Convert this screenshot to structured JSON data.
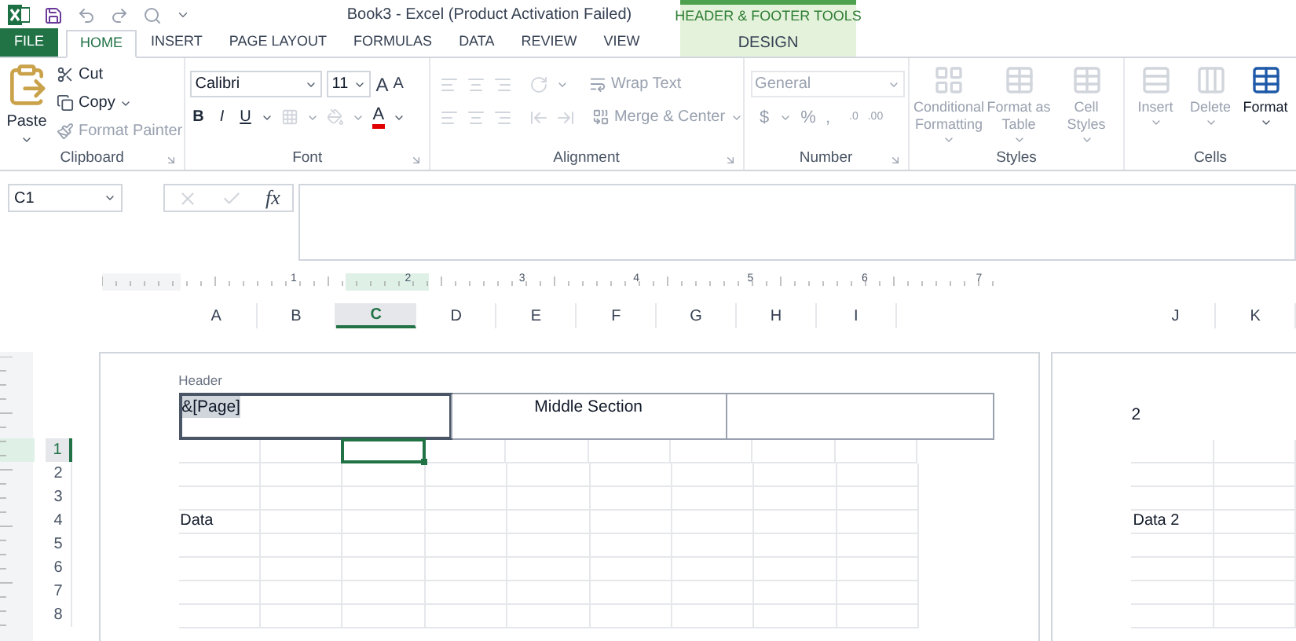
{
  "window": {
    "title": "Book3 - Excel (Product Activation Failed)"
  },
  "contextual_group": {
    "label": "HEADER & FOOTER TOOLS"
  },
  "tabs": [
    {
      "label": "FILE",
      "kind": "file",
      "selected": false
    },
    {
      "label": "HOME",
      "kind": "main",
      "selected": true
    },
    {
      "label": "INSERT",
      "kind": "main",
      "selected": false
    },
    {
      "label": "PAGE LAYOUT",
      "kind": "main",
      "selected": false
    },
    {
      "label": "FORMULAS",
      "kind": "main",
      "selected": false
    },
    {
      "label": "DATA",
      "kind": "main",
      "selected": false
    },
    {
      "label": "REVIEW",
      "kind": "main",
      "selected": false
    },
    {
      "label": "VIEW",
      "kind": "main",
      "selected": false
    },
    {
      "label": "DESIGN",
      "kind": "contextual",
      "selected": false
    }
  ],
  "ribbon_groups": [
    {
      "kind": "clipboard",
      "label": "Clipboard",
      "buttons": [
        {
          "label": "Paste",
          "disabled": false
        },
        {
          "label": "Cut",
          "disabled": false
        },
        {
          "label": "Copy",
          "disabled": false
        },
        {
          "label": "Format Painter",
          "disabled": true
        }
      ]
    },
    {
      "kind": "font",
      "label": "Font",
      "font_name": "Calibri",
      "font_size": "11",
      "size_buttons": [
        "A",
        "A"
      ],
      "style_buttons": [
        "B",
        "I",
        "U"
      ],
      "font_color": "A"
    },
    {
      "kind": "alignment",
      "label": "Alignment",
      "buttons": [
        {
          "label": "Wrap Text",
          "disabled": true
        },
        {
          "label": "Merge & Center",
          "disabled": true
        }
      ]
    },
    {
      "kind": "number",
      "label": "Number",
      "format": "General",
      "disabled": true,
      "symbols": [
        "$",
        "%",
        ","
      ],
      "decimal_buttons": [
        ".0",
        ".00"
      ]
    },
    {
      "kind": "large",
      "label": "Styles",
      "buttons": [
        {
          "label": "Conditional Formatting",
          "disabled": true
        },
        {
          "label": "Format as Table",
          "disabled": true
        },
        {
          "label": "Cell Styles",
          "disabled": true
        }
      ]
    },
    {
      "kind": "large",
      "label": "Cells",
      "buttons": [
        {
          "label": "Insert",
          "disabled": true
        },
        {
          "label": "Delete",
          "disabled": true
        },
        {
          "label": "Format",
          "disabled": false
        }
      ]
    }
  ],
  "formula_bar": {
    "function_label": "fx"
  },
  "ruler_marks": [
    "1",
    "2",
    "3",
    "4",
    "5",
    "6",
    "7"
  ],
  "sheet": {
    "active_cell": "C1",
    "columns": [
      {
        "label": "A",
        "selected": false
      },
      {
        "label": "B",
        "selected": false
      },
      {
        "label": "C",
        "selected": true
      },
      {
        "label": "D",
        "selected": false
      },
      {
        "label": "E",
        "selected": false
      },
      {
        "label": "F",
        "selected": false
      },
      {
        "label": "G",
        "selected": false
      },
      {
        "label": "H",
        "selected": false
      },
      {
        "label": "I",
        "selected": false
      }
    ],
    "rows": [
      {
        "label": "1",
        "selected": true
      },
      {
        "label": "2",
        "selected": false
      },
      {
        "label": "3",
        "selected": false
      },
      {
        "label": "4",
        "selected": false,
        "column_A": "Data",
        "column_J": "Data 2"
      },
      {
        "label": "5",
        "selected": false
      },
      {
        "label": "6",
        "selected": false
      },
      {
        "label": "7",
        "selected": false
      },
      {
        "label": "8",
        "selected": false
      }
    ],
    "page_1": {
      "header_label": "Header",
      "header_sections": [
        {
          "text": "&[Page]",
          "selected": true
        },
        {
          "text": "Middle Section",
          "selected": false
        },
        {
          "selected": false
        }
      ]
    },
    "page_2": {
      "header_text": "2",
      "columns": [
        {
          "label": "J",
          "selected": false
        },
        {
          "label": "K",
          "selected": false
        }
      ]
    }
  }
}
